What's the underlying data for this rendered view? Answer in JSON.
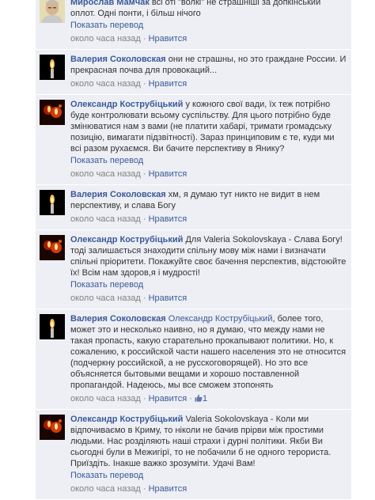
{
  "comments": [
    {
      "avatar": "photo-man-icon",
      "author": "Мирослав Мамчак",
      "text": "всі оті \"волкі\" не страшніші за допкінський оплот. Одні понти, і більш нічого",
      "translate": "Показать перевод",
      "time": "около часа назад",
      "like": "Нравится"
    },
    {
      "avatar": "candle-icon",
      "author": "Валерия Соколовская",
      "text": "они не страшны, но это граждане России. И прекрасная почва для провокаций...",
      "time": "около часа назад",
      "like": "Нравится"
    },
    {
      "avatar": "candles-icon",
      "author": "Олександр Кострубіцький",
      "text": "у кожного свої вади, їх теж потрібно буде контролювати всьому суспільству. Для цього потрібно буде змінюватися нам з вами (не платити хабарі, тримати громадську позицію, вимагати підзвітності). Зараз принциповим є те, куди ми всі разом рухаємся. Ви бачите перспективу в Янику?",
      "translate": "Показать перевод",
      "time": "около часа назад",
      "like": "Нравится"
    },
    {
      "avatar": "candle-icon",
      "author": "Валерия Соколовская",
      "text": "хм, я думаю тут никто не видит в нем перспективу, и слава Богу",
      "time": "около часа назад",
      "like": "Нравится"
    },
    {
      "avatar": "candles-icon",
      "author": "Олександр Кострубіцький",
      "text": "Для Valeria Sokolovskaya - Слава Богу! тоді залишається знаходити спільну мову між нами і визначати спільні пріоритети. Покажуйте своє бачення перспектив, відстоюйте їх! Всім нам здоров,я і мудрості!",
      "translate": "Показать перевод",
      "time": "около часа назад",
      "like": "Нравится"
    },
    {
      "avatar": "candle-icon",
      "author": "Валерия Соколовская",
      "mention": "Олександр Кострубіцький",
      "text": ", более того, может это и несколько наивно, но я думаю, что между нами не такая пропасть, какую старательно прокапывают политики. Но, к сожалению, к российской части нашего населения это не относится (подчеркну российской, а не русскоговорящей). Но это все объясняется бытовыми вещами и хорошо поставленной пропагандой. Надеюсь, мы все сможем зтопонять",
      "time": "около часа назад",
      "like": "Нравится",
      "likes": "1"
    },
    {
      "avatar": "candles-icon",
      "author": "Олександр Кострубіцький",
      "text": "Valeria Sokolovskaya - Коли ми відпочиваємо в Криму, то ніколи не бачив прірви між простими людьми. Нас розділяють наші страхи і дурні політики. Якби Ви сьогодні були в Межигірї, то не побачили б не одного терориста. Приїздіть. Інакше важко зрозуміти. Удачі Вам!",
      "translate": "Показать перевод",
      "time": "около часа назад",
      "like": "Нравится"
    }
  ]
}
